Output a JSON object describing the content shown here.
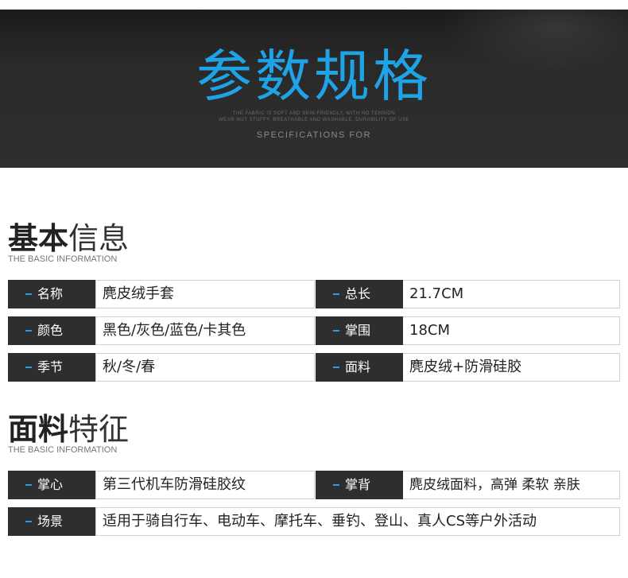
{
  "banner": {
    "title": "参数规格",
    "fine_line_1": "THE FABRIC IS SOFT AND SKIN-FRIENDLY, WITH NO TENSION",
    "fine_line_2": "WEAR NOT STUFFY, BREATHABLE AND WASHABLE, DURABILITY OF USE",
    "subtitle": "SPECIFICATIONS FOR",
    "accent_color": "#1ea3e6"
  },
  "basic": {
    "title_strong": "基本",
    "title_light": "信息",
    "subtitle": "THE BASIC INFORMATION",
    "rows": [
      {
        "left_label": "名称",
        "left_value": "麂皮绒手套",
        "right_label": "总长",
        "right_value": "21.7CM"
      },
      {
        "left_label": "颜色",
        "left_value": "黑色/灰色/蓝色/卡其色",
        "right_label": "掌围",
        "right_value": "18CM"
      },
      {
        "left_label": "季节",
        "left_value": "秋/冬/春",
        "right_label": "面料",
        "right_value": "麂皮绒+防滑硅胶"
      }
    ]
  },
  "material": {
    "title_strong": "面料",
    "title_light": "特征",
    "subtitle": "THE BASIC INFORMATION",
    "rows": [
      {
        "left_label": "掌心",
        "left_value": "第三代机车防滑硅胶纹",
        "right_label": "掌背",
        "right_value": "麂皮绒面料，高弹 柔软 亲肤"
      }
    ],
    "scene": {
      "label": "场景",
      "value": "适用于骑自行车、电动车、摩托车、垂钓、登山、真人CS等户外活动"
    }
  }
}
